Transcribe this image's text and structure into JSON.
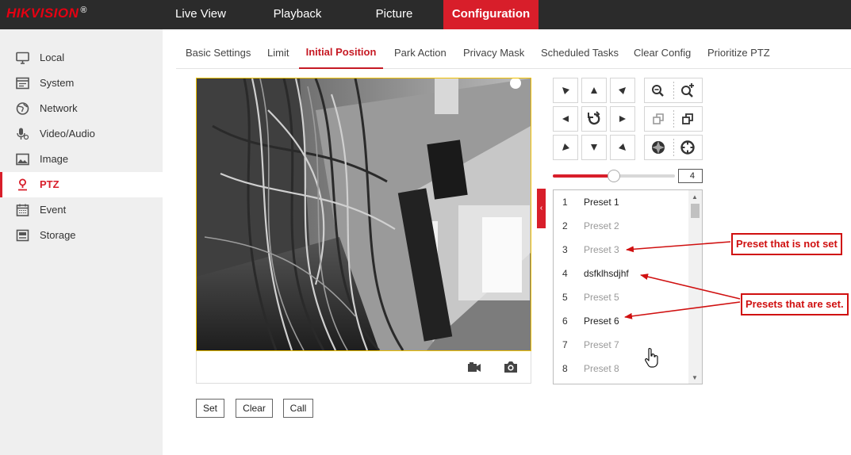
{
  "brand": {
    "logo_text": "HIKVISION",
    "logo_mark": "®",
    "color": "#e60012"
  },
  "top_nav": {
    "items": [
      {
        "label": "Live View",
        "active": false
      },
      {
        "label": "Playback",
        "active": false
      },
      {
        "label": "Picture",
        "active": false
      },
      {
        "label": "Configuration",
        "active": true
      }
    ],
    "active_color": "#d81e2a"
  },
  "sidebar": {
    "items": [
      {
        "label": "Local",
        "icon": "monitor-icon"
      },
      {
        "label": "System",
        "icon": "system-icon"
      },
      {
        "label": "Network",
        "icon": "globe-icon"
      },
      {
        "label": "Video/Audio",
        "icon": "microphone-icon"
      },
      {
        "label": "Image",
        "icon": "image-icon"
      },
      {
        "label": "PTZ",
        "icon": "ptz-icon",
        "active": true
      },
      {
        "label": "Event",
        "icon": "calendar-icon"
      },
      {
        "label": "Storage",
        "icon": "storage-icon"
      }
    ]
  },
  "tabs": [
    {
      "label": "Basic Settings"
    },
    {
      "label": "Limit"
    },
    {
      "label": "Initial Position",
      "active": true
    },
    {
      "label": "Park Action"
    },
    {
      "label": "Privacy Mask"
    },
    {
      "label": "Scheduled Tasks"
    },
    {
      "label": "Clear Config"
    },
    {
      "label": "Prioritize PTZ"
    }
  ],
  "ptz": {
    "speed_value": "4",
    "speed_fraction": 0.5
  },
  "presets": [
    {
      "num": "1",
      "name": "Preset 1",
      "set": true
    },
    {
      "num": "2",
      "name": "Preset 2",
      "set": false
    },
    {
      "num": "3",
      "name": "Preset 3",
      "set": false
    },
    {
      "num": "4",
      "name": "dsfklhsdjhf",
      "set": true
    },
    {
      "num": "5",
      "name": "Preset 5",
      "set": false
    },
    {
      "num": "6",
      "name": "Preset 6",
      "set": true
    },
    {
      "num": "7",
      "name": "Preset 7",
      "set": false
    },
    {
      "num": "8",
      "name": "Preset 8",
      "set": false
    }
  ],
  "actions": {
    "set_label": "Set",
    "clear_label": "Clear",
    "call_label": "Call"
  },
  "annotations": {
    "not_set": "Preset that is not set",
    "are_set": "Presets that are set.",
    "color": "#d01010"
  }
}
